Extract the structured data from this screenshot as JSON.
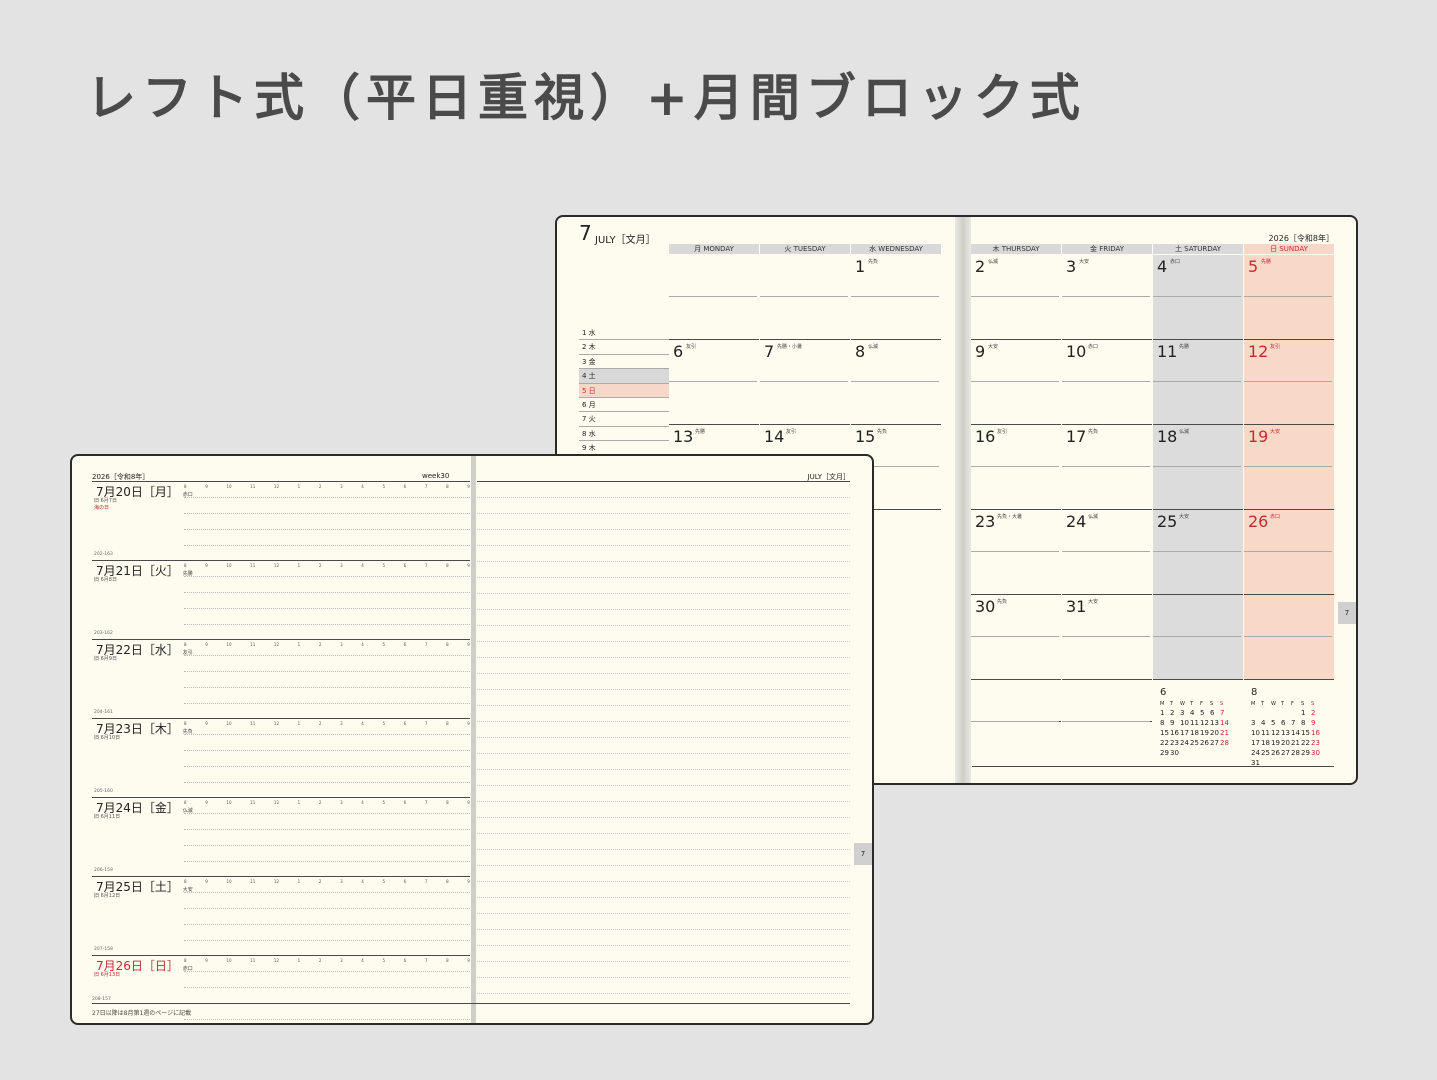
{
  "heading": "レフト式（平日重視）+月間ブロック式",
  "monthly": {
    "month_num": "7",
    "month_en": "JULY［文月］",
    "year": "2026［令和8年］",
    "days_of_week_left": [
      "月 MONDAY",
      "火 TUESDAY",
      "水 WEDNESDAY"
    ],
    "days_of_week_right": [
      "木 THURSDAY",
      "金 FRIDAY",
      "土 SATURDAY",
      "日 SUNDAY"
    ],
    "list_rows": [
      "1 水",
      "2 木",
      "3 金",
      "4 土",
      "5 日",
      "6 月",
      "7 火",
      "8 水",
      "9 木"
    ],
    "weeks_left": [
      [
        {
          "n": "",
          "r": ""
        },
        {
          "n": "",
          "r": ""
        },
        {
          "n": "1",
          "r": "先負"
        }
      ],
      [
        {
          "n": "6",
          "r": "友引"
        },
        {
          "n": "7",
          "r": "先勝・小暑"
        },
        {
          "n": "8",
          "r": "仏滅"
        }
      ],
      [
        {
          "n": "13",
          "r": "先勝"
        },
        {
          "n": "14",
          "r": "友引"
        },
        {
          "n": "15",
          "r": "先負"
        }
      ]
    ],
    "weeks_right": [
      [
        {
          "n": "2",
          "r": "仏滅"
        },
        {
          "n": "3",
          "r": "大安"
        },
        {
          "n": "4",
          "r": "赤口"
        },
        {
          "n": "5",
          "r": "先勝"
        }
      ],
      [
        {
          "n": "9",
          "r": "大安"
        },
        {
          "n": "10",
          "r": "赤口"
        },
        {
          "n": "11",
          "r": "先勝"
        },
        {
          "n": "12",
          "r": "友引"
        }
      ],
      [
        {
          "n": "16",
          "r": "友引"
        },
        {
          "n": "17",
          "r": "先負"
        },
        {
          "n": "18",
          "r": "仏滅"
        },
        {
          "n": "19",
          "r": "大安"
        }
      ],
      [
        {
          "n": "23",
          "r": "先負・大暑"
        },
        {
          "n": "24",
          "r": "仏滅"
        },
        {
          "n": "25",
          "r": "大安"
        },
        {
          "n": "26",
          "r": "赤口"
        }
      ],
      [
        {
          "n": "30",
          "r": "先負"
        },
        {
          "n": "31",
          "r": "大安"
        },
        {
          "n": "",
          "r": ""
        },
        {
          "n": "",
          "r": ""
        }
      ]
    ],
    "mini_cal_june": {
      "month": "6",
      "head": [
        "M",
        "T",
        "W",
        "T",
        "F",
        "S",
        "S"
      ],
      "rows": [
        [
          "1",
          "2",
          "3",
          "4",
          "5",
          "6",
          "7"
        ],
        [
          "8",
          "9",
          "10",
          "11",
          "12",
          "13",
          "14"
        ],
        [
          "15",
          "16",
          "17",
          "18",
          "19",
          "20",
          "21"
        ],
        [
          "22",
          "23",
          "24",
          "25",
          "26",
          "27",
          "28"
        ],
        [
          "29",
          "30",
          "",
          "",
          "",
          "",
          ""
        ]
      ]
    },
    "mini_cal_aug": {
      "month": "8",
      "head": [
        "M",
        "T",
        "W",
        "T",
        "F",
        "S",
        "S"
      ],
      "rows": [
        [
          "",
          "",
          "",
          "",
          "",
          "1",
          "2"
        ],
        [
          "3",
          "4",
          "5",
          "6",
          "7",
          "8",
          "9"
        ],
        [
          "10",
          "11",
          "12",
          "13",
          "14",
          "15",
          "16"
        ],
        [
          "17",
          "18",
          "19",
          "20",
          "21",
          "22",
          "23"
        ],
        [
          "24",
          "25",
          "26",
          "27",
          "28",
          "29",
          "30"
        ],
        [
          "31",
          "",
          "",
          "",
          "",
          "",
          ""
        ]
      ]
    },
    "tab": "7"
  },
  "weekly": {
    "year": "2026［令和8年］",
    "week": "week30",
    "month_right": "JULY［文月］",
    "hours": [
      "8",
      "9",
      "10",
      "11",
      "12",
      "1",
      "2",
      "3",
      "4",
      "5",
      "6",
      "7",
      "8",
      "9"
    ],
    "days": [
      {
        "date": "7月20日［月］",
        "roku": "赤口",
        "sub": "旧 6月7日",
        "sub2": "海の日",
        "count": "",
        "sun": false
      },
      {
        "date": "7月21日［火］",
        "roku": "先勝",
        "sub": "旧 6月8日",
        "sub2": "",
        "count": "202-163",
        "sun": false
      },
      {
        "date": "7月22日［水］",
        "roku": "友引",
        "sub": "旧 6月9日",
        "sub2": "",
        "count": "203-162",
        "sun": false
      },
      {
        "date": "7月23日［木］",
        "roku": "先負",
        "sub": "旧 6月10日",
        "sub2": "",
        "count": "204-161",
        "sun": false
      },
      {
        "date": "7月24日［金］",
        "roku": "仏滅",
        "sub": "旧 6月11日",
        "sub2": "",
        "count": "205-160",
        "sun": false
      },
      {
        "date": "7月25日［土］",
        "roku": "大安",
        "sub": "旧 6月12日",
        "sub2": "",
        "count": "206-159",
        "sun": false
      },
      {
        "date": "7月26日［日］",
        "roku": "赤口",
        "sub": "旧 6月13日",
        "sub2": "",
        "count": "207-158",
        "sun": true
      }
    ],
    "bottom_note": "27日以降は8月第1週のページに記載",
    "bottom_count": "208-157",
    "tab": "7"
  }
}
